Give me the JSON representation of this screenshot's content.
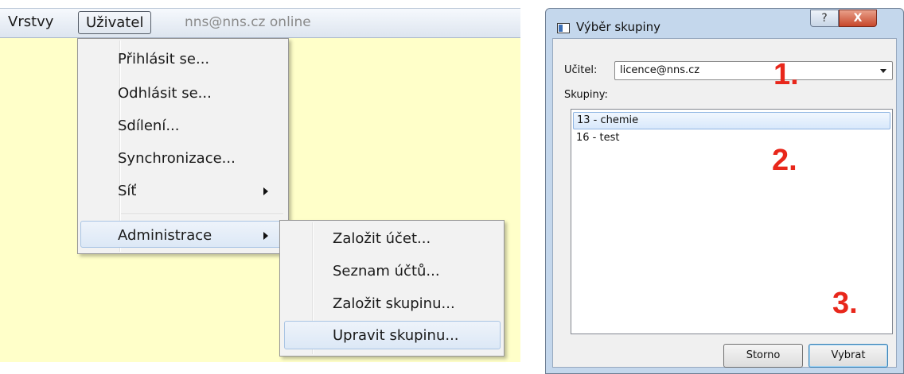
{
  "menubar": {
    "items": [
      "Vrstvy",
      "Uživatel"
    ],
    "status": "nns@nns.cz online"
  },
  "user_menu": {
    "items": [
      "Přihlásit se...",
      "Odhlásit se...",
      "Sdílení...",
      "Synchronizace...",
      "Síť",
      "Administrace"
    ]
  },
  "admin_submenu": {
    "items": [
      "Založit účet...",
      "Seznam účtů...",
      "Založit skupinu...",
      "Upravit skupinu..."
    ]
  },
  "dialog": {
    "title": "Výběr skupiny",
    "help_glyph": "?",
    "close_glyph": "X",
    "teacher_label": "Učitel:",
    "teacher_value": "licence@nns.cz",
    "groups_label": "Skupiny:",
    "groups": [
      "13 - chemie",
      "16 - test"
    ],
    "selected_group": "13 - chemie",
    "cancel_label": "Storno",
    "ok_label": "Vybrat"
  },
  "annotations": [
    "1.",
    "2.",
    "3."
  ],
  "colors": {
    "canvas": "#ffffc9",
    "annotation_red": "#e8271b",
    "selection_border": "#8fb5e2"
  }
}
